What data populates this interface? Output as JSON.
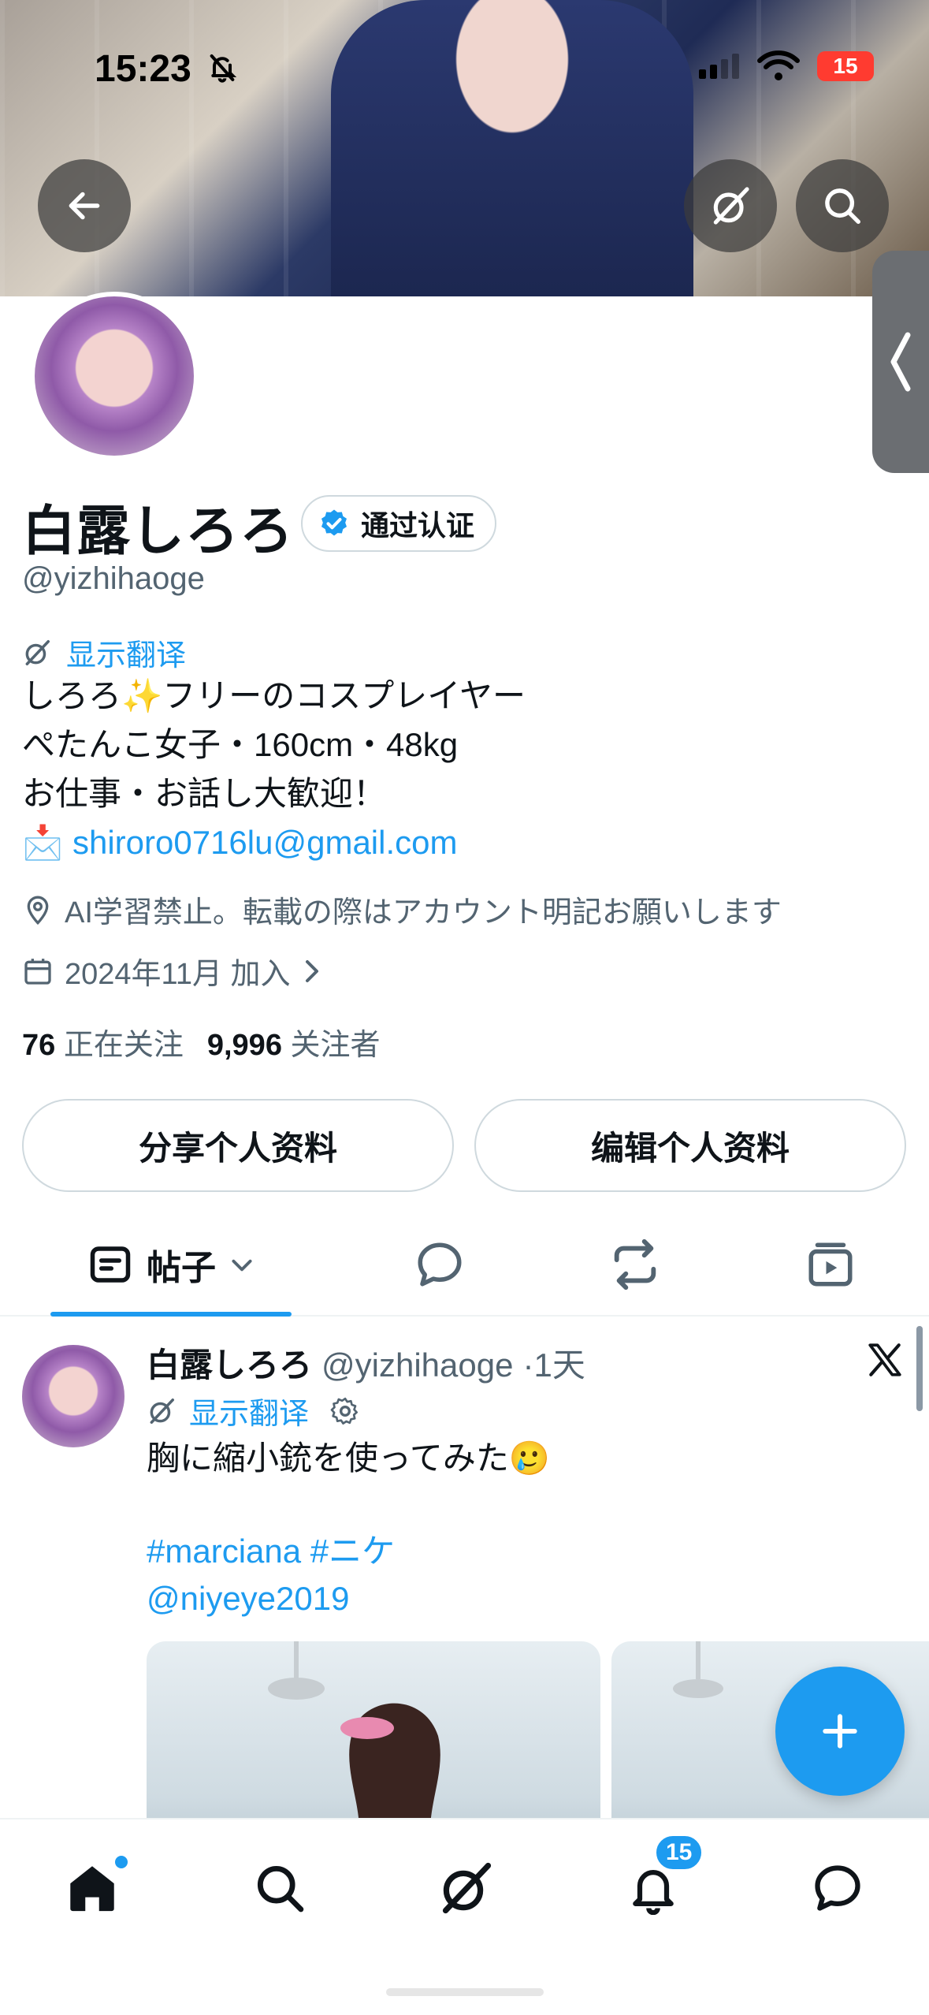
{
  "status_bar": {
    "time": "15:23",
    "battery": "15"
  },
  "profile": {
    "display_name": "白露しろろ",
    "verified_label": "通过认证",
    "handle": "@yizhihaoge",
    "translate_label": "显示翻译",
    "bio_lines": [
      "しろろ✨フリーのコスプレイヤー",
      "ぺたんこ女子・160cm・48kg",
      "お仕事・お話し大歓迎！"
    ],
    "email_emoji": "📩",
    "email": "shiroro0716lu@gmail.com",
    "location": "AI学習禁止。転載の際はアカウント明記お願いします",
    "joined": "2024年11月 加入",
    "following_count": "76",
    "following_label": "正在关注",
    "followers_count": "9,996",
    "followers_label": "关注者"
  },
  "actions": {
    "share_label": "分享个人资料",
    "edit_label": "编辑个人资料"
  },
  "tabs": {
    "posts_label": "帖子"
  },
  "post": {
    "author": "白露しろろ",
    "handle": "@yizhihaoge",
    "time": "·1天",
    "translate_label": "显示翻译",
    "text": "胸に縮小銃を使ってみた🥲",
    "hashtags": "#marciana #ニケ",
    "mention": "@niyeye2019"
  },
  "nav": {
    "notifications_badge": "15"
  },
  "colors": {
    "accent": "#1d9bf0",
    "text": "#0f1419",
    "muted": "#536471",
    "border": "#cfd9de"
  }
}
